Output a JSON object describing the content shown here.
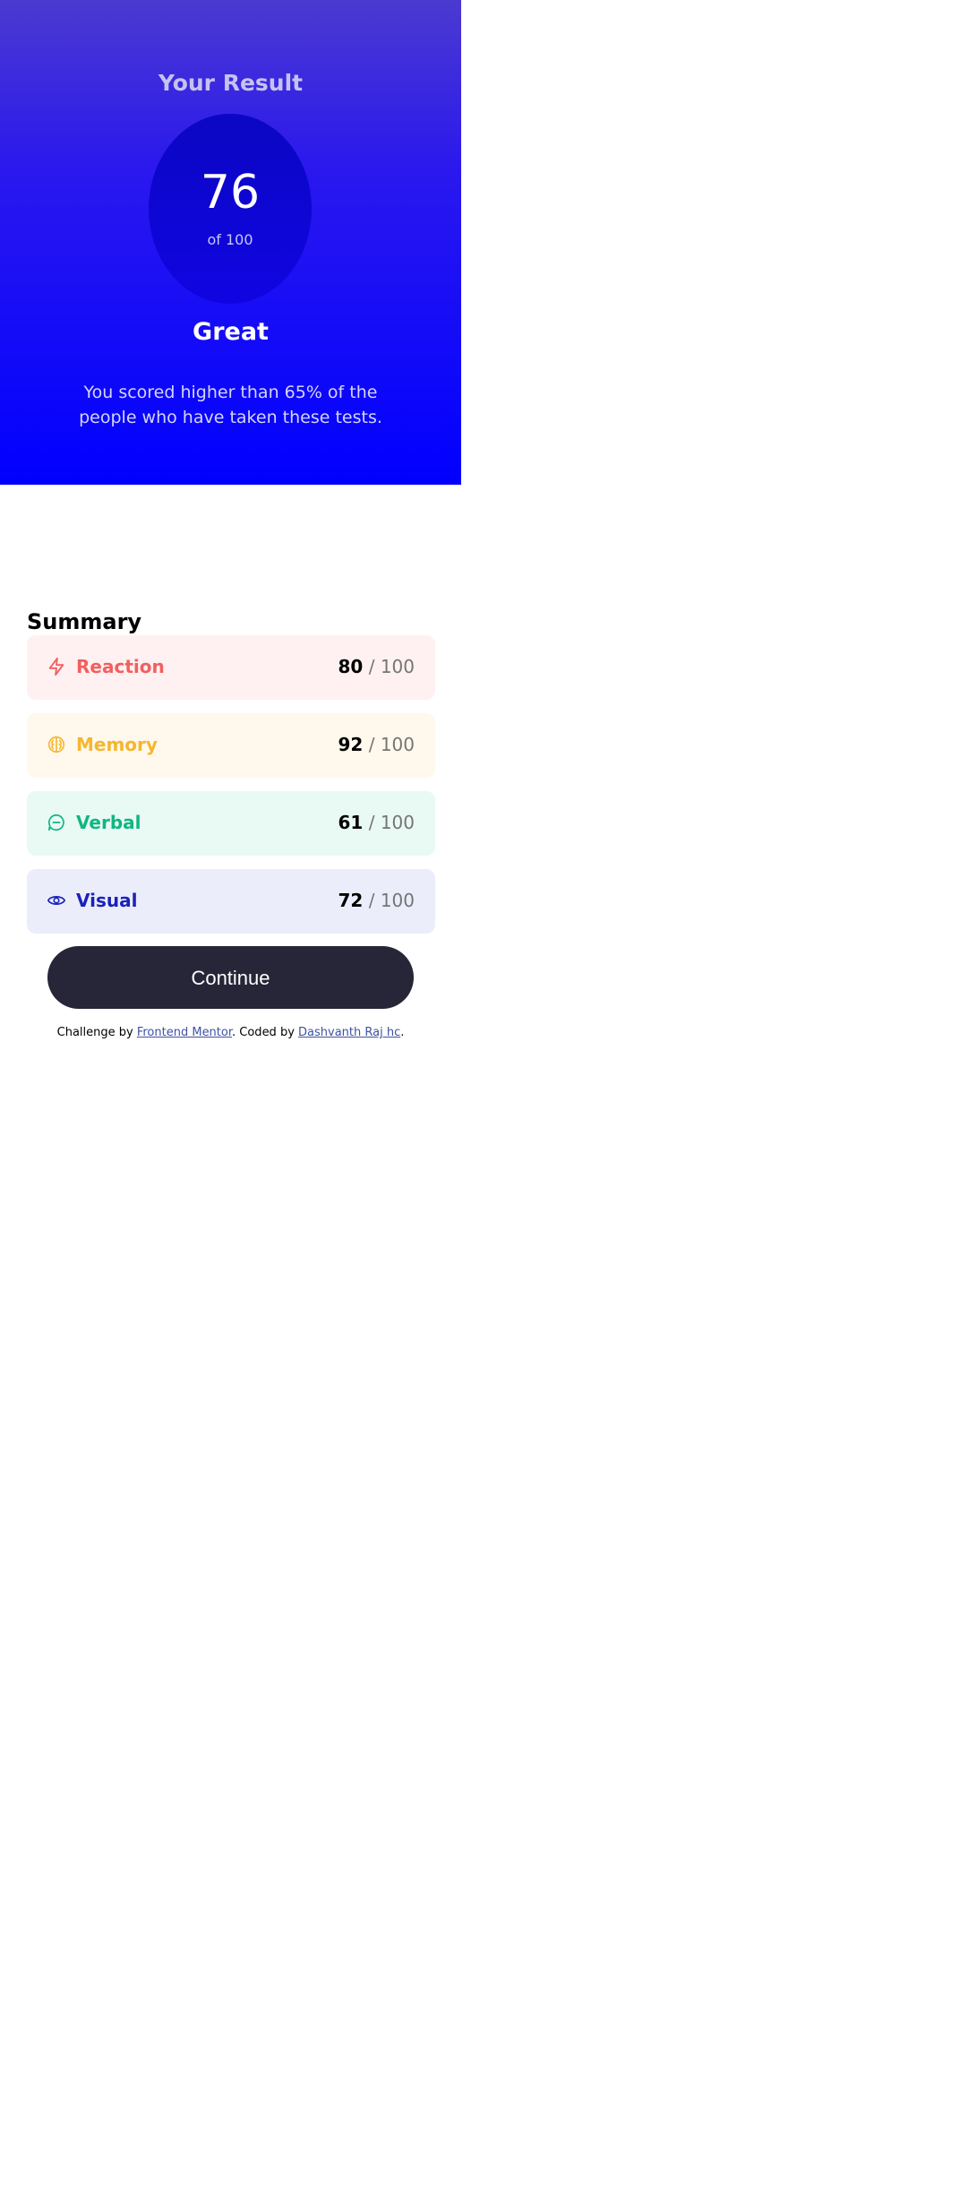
{
  "result": {
    "heading": "Your Result",
    "score": "76",
    "score_max": "of 100",
    "rating": "Great",
    "description": "You scored higher than 65% of the people who have taken these tests."
  },
  "summary": {
    "title": "Summary",
    "items": [
      {
        "label": "Reaction",
        "score": "80",
        "max": "/ 100",
        "icon": "lightning-icon",
        "color": "#f25f5f",
        "background": "#fff1f1"
      },
      {
        "label": "Memory",
        "score": "92",
        "max": "/ 100",
        "icon": "brain-icon",
        "color": "#f5b630",
        "background": "#fff8ec"
      },
      {
        "label": "Verbal",
        "score": "61",
        "max": "/ 100",
        "icon": "chat-bubble-icon",
        "color": "#10b683",
        "background": "#e9f9f3"
      },
      {
        "label": "Visual",
        "score": "72",
        "max": "/ 100",
        "icon": "eye-icon",
        "color": "#1a22b8",
        "background": "#ecedfb"
      }
    ]
  },
  "continue_button": {
    "label": "Continue"
  },
  "attribution": {
    "prefix": "Challenge by ",
    "link1": "Frontend Mentor",
    "middle": ". Coded by ",
    "link2": "Dashvanth Raj hc",
    "suffix": "."
  },
  "colors": {
    "panel_top": "#4b3ad0",
    "panel_bottom": "#0000ff",
    "button": "#262638"
  }
}
